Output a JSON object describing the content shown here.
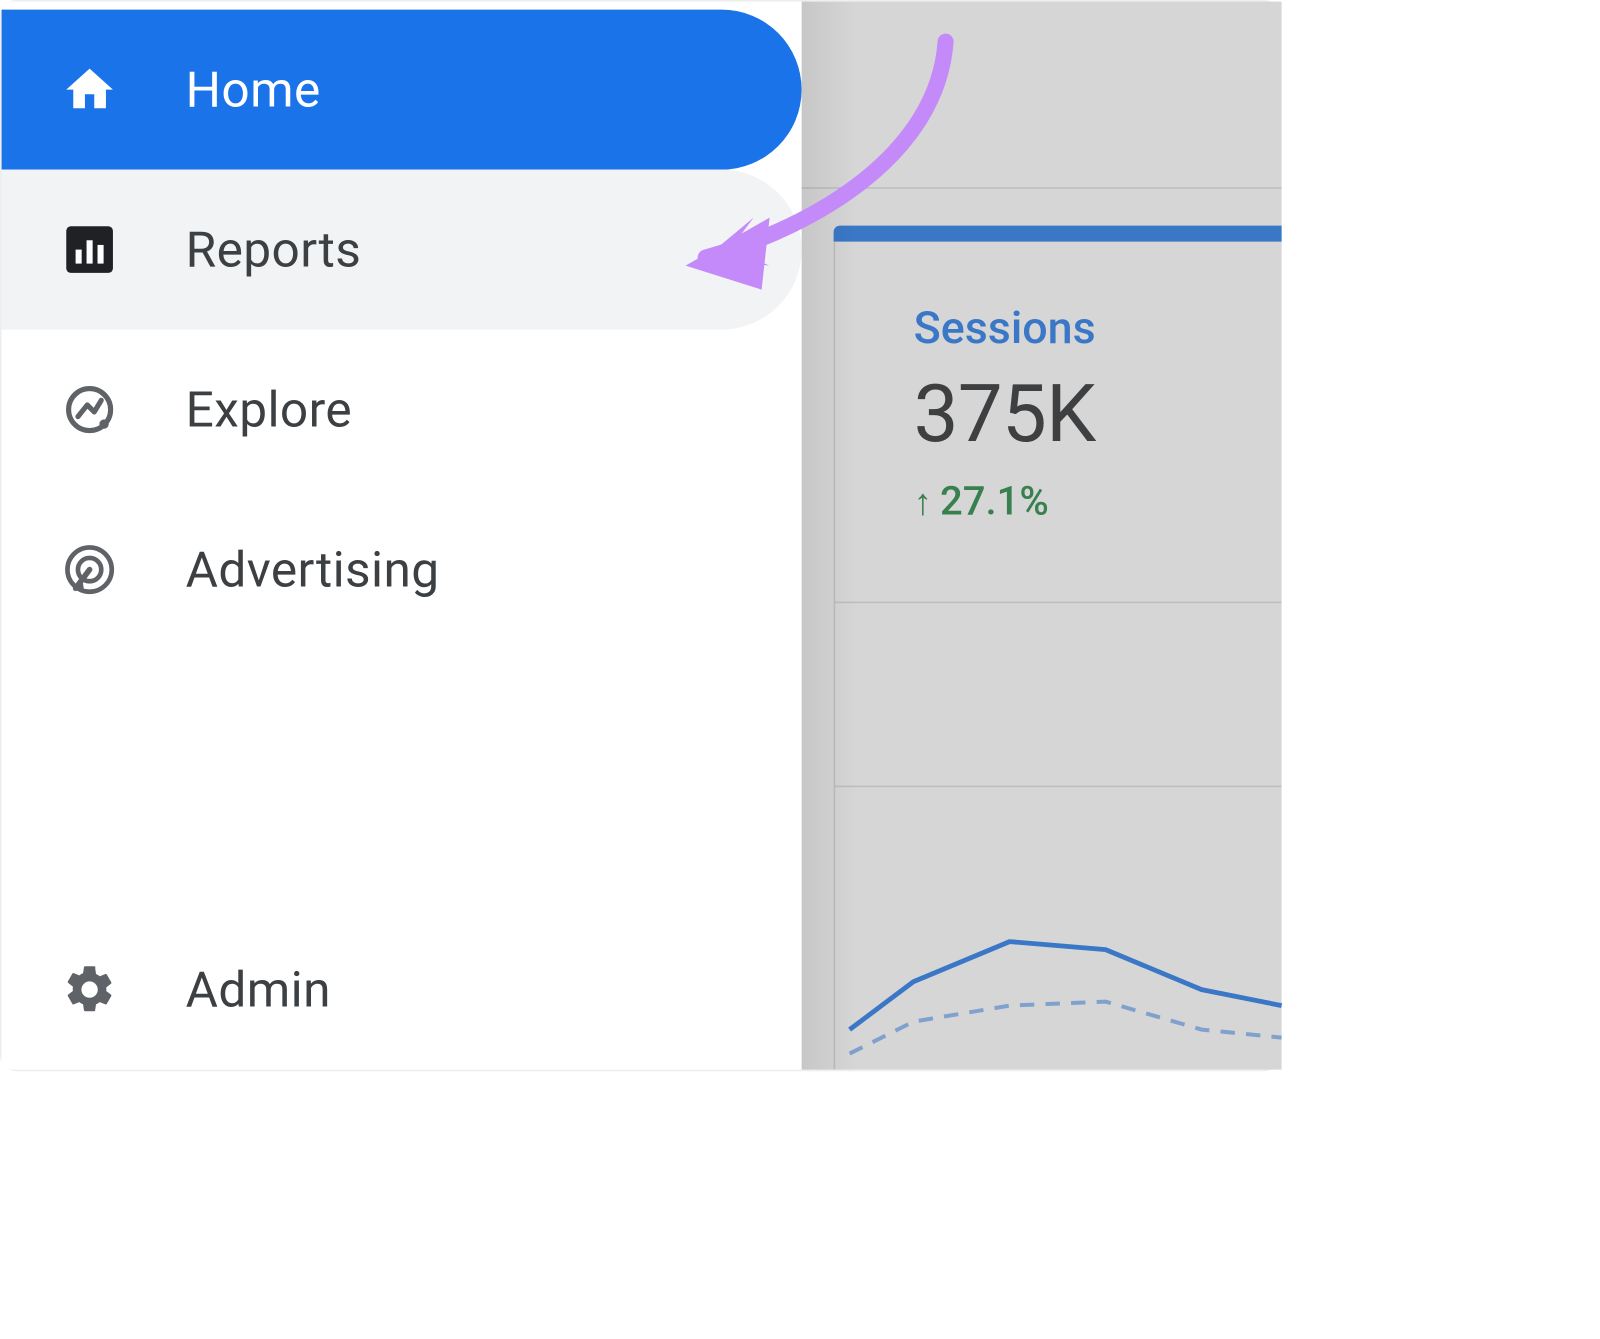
{
  "sidebar": {
    "items": [
      {
        "label": "Home",
        "active": true,
        "hover": false
      },
      {
        "label": "Reports",
        "active": false,
        "hover": true
      },
      {
        "label": "Explore",
        "active": false,
        "hover": false
      },
      {
        "label": "Advertising",
        "active": false,
        "hover": false
      }
    ],
    "admin_label": "Admin"
  },
  "metric": {
    "label": "Sessions",
    "value": "375K",
    "delta": "27.1%",
    "delta_direction": "up"
  },
  "colors": {
    "primary": "#1a73e8",
    "positive": "#188038",
    "annotation": "#c58af9"
  },
  "annotation": {
    "target": "Reports"
  }
}
